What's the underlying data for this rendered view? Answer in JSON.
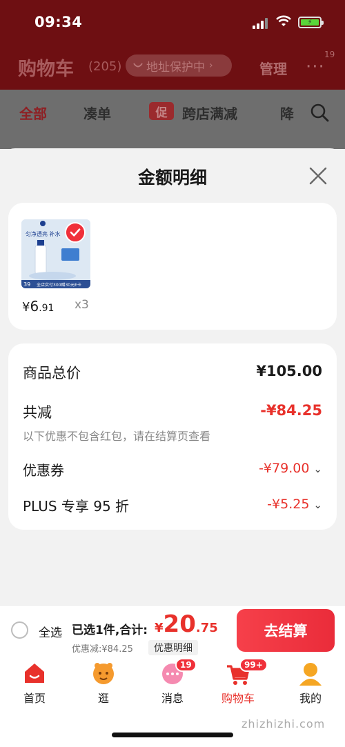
{
  "status_bar": {
    "time": "09:34"
  },
  "header": {
    "title": "购物车",
    "count": "(205)",
    "address_pill": "地址保护中",
    "manage": "管理",
    "more_badge": "19"
  },
  "filter_tabs": {
    "all": "全部",
    "bundle": "凑单",
    "promo_tag": "促",
    "cross_store": "跨店满减",
    "price_drop": "降"
  },
  "sheet": {
    "title": "金额明细",
    "product": {
      "price_symbol": "¥",
      "price_int": "6",
      "price_dec": ".91",
      "quantity": "x3",
      "thumb_text_top": "匀净透亮 补水",
      "thumb_price_tag": "39",
      "thumb_banner": "全店实付300赠30元E卡"
    },
    "rows": {
      "subtotal_label": "商品总价",
      "subtotal_value": "¥105.00",
      "reduction_label": "共减",
      "reduction_value": "-¥84.25",
      "reduction_note": "以下优惠不包含红包，请在结算页查看",
      "coupon_label": "优惠券",
      "coupon_value": "-¥79.00",
      "plus_label": "PLUS 专享 95 折",
      "plus_value": "-¥5.25"
    }
  },
  "checkout": {
    "select_all": "全选",
    "selected_text": "已选1件,合计:",
    "total_symbol": "¥",
    "total_int": "20",
    "total_dec": ".75",
    "discount_text": "优惠减:¥84.25",
    "detail_chip": "优惠明细",
    "pay_button": "去结算"
  },
  "tabbar": {
    "home": "首页",
    "browse": "逛",
    "messages": "消息",
    "messages_badge": "19",
    "cart": "购物车",
    "cart_badge": "99+",
    "mine": "我的"
  },
  "watermark": "zhizhizhi.com",
  "colors": {
    "accent": "#e8312b",
    "header_bg": "#6e0f12"
  }
}
